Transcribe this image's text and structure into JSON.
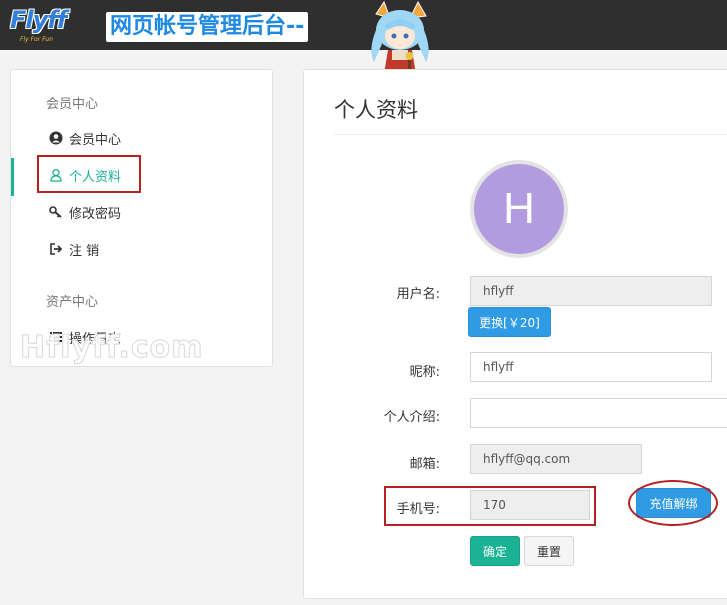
{
  "header": {
    "logo_text": "Flyff",
    "logo_sub": "Fly For Fun",
    "banner_title": "网页帐号管理后台--"
  },
  "sidebar": {
    "section_member": "会员中心",
    "items": [
      {
        "label": "会员中心",
        "icon": "user-circle-icon"
      },
      {
        "label": "个人资料",
        "icon": "user-icon",
        "active": true
      },
      {
        "label": "修改密码",
        "icon": "key-icon"
      },
      {
        "label": "注 销",
        "icon": "sign-out-icon"
      }
    ],
    "section_assets": "资产中心",
    "asset_items": [
      {
        "label": "操作日志",
        "icon": "list-icon"
      }
    ],
    "watermark": "Hflyff.com"
  },
  "main": {
    "title": "个人资料",
    "avatar_letter": "H",
    "fields": {
      "username_label": "用户名:",
      "username_value": "hflyff",
      "change_button": "更换[￥20]",
      "nickname_label": "昵称:",
      "nickname_value": "hflyff",
      "intro_label": "个人介绍:",
      "intro_value": "",
      "email_label": "邮箱:",
      "email_value": "hflyff@qq.com",
      "phone_label": "手机号:",
      "phone_value": "170",
      "unbind_button": "充值解绑"
    },
    "confirm_button": "确定",
    "reset_button": "重置"
  },
  "colors": {
    "accent_green": "#1ab394",
    "button_blue": "#2f9be5",
    "annotation_red": "#b52020",
    "avatar_purple": "#b39be0"
  }
}
